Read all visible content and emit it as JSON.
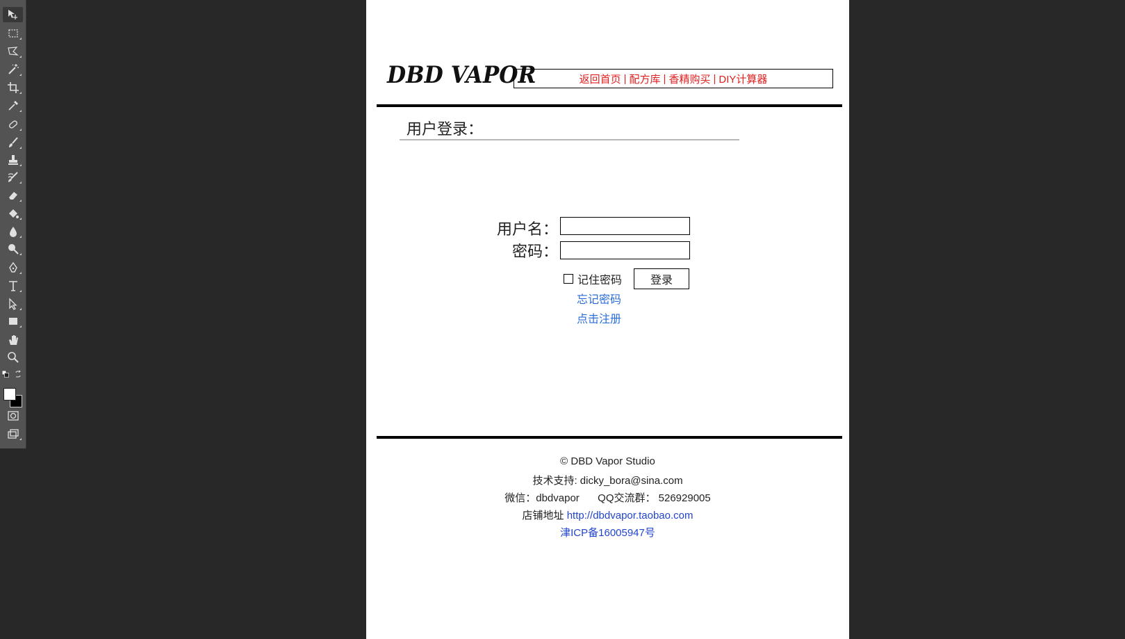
{
  "toolbar": {
    "tools": [
      {
        "icon": "move-icon"
      },
      {
        "icon": "rectangular-marquee-icon"
      },
      {
        "icon": "polygonal-lasso-icon"
      },
      {
        "icon": "magic-wand-icon"
      },
      {
        "icon": "crop-icon"
      },
      {
        "icon": "eyedropper-icon"
      },
      {
        "icon": "healing-brush-icon"
      },
      {
        "icon": "brush-icon"
      },
      {
        "icon": "clone-stamp-icon"
      },
      {
        "icon": "history-brush-icon"
      },
      {
        "icon": "eraser-icon"
      },
      {
        "icon": "paint-bucket-icon"
      },
      {
        "icon": "blur-icon"
      },
      {
        "icon": "dodge-icon"
      },
      {
        "icon": "pen-icon"
      },
      {
        "icon": "type-icon"
      },
      {
        "icon": "path-selection-icon"
      },
      {
        "icon": "rectangle-shape-icon"
      },
      {
        "icon": "hand-icon"
      },
      {
        "icon": "zoom-icon"
      }
    ],
    "foreground_color": "#ffffff",
    "background_color": "#000000"
  },
  "page": {
    "logo": "DBD VAPOR",
    "nav": {
      "home": "返回首页",
      "recipes": "配方库",
      "buy": "香精购买",
      "calculator": "DIY计算器",
      "separator": "|"
    },
    "section_title": "用户登录：",
    "login_form": {
      "username_label": "用户名：",
      "password_label": "密码：",
      "remember_label": "记住密码",
      "login_button": "登录",
      "forgot_link": "忘记密码",
      "register_link": "点击注册"
    },
    "footer": {
      "copyright": "© DBD Vapor Studio",
      "support": "技术支持: dicky_bora@sina.com",
      "wechat": "微信：dbdvapor",
      "qq": "QQ交流群： 526929005",
      "shop_label": "店铺地址",
      "shop_url": "http://dbdvapor.taobao.com",
      "icp": "津ICP备16005947号"
    }
  },
  "colors": {
    "nav_text": "#e02020",
    "link_blue": "#2a6dd9",
    "footer_link": "#2244cc",
    "workspace": "#282828",
    "toolbar": "#535353"
  }
}
